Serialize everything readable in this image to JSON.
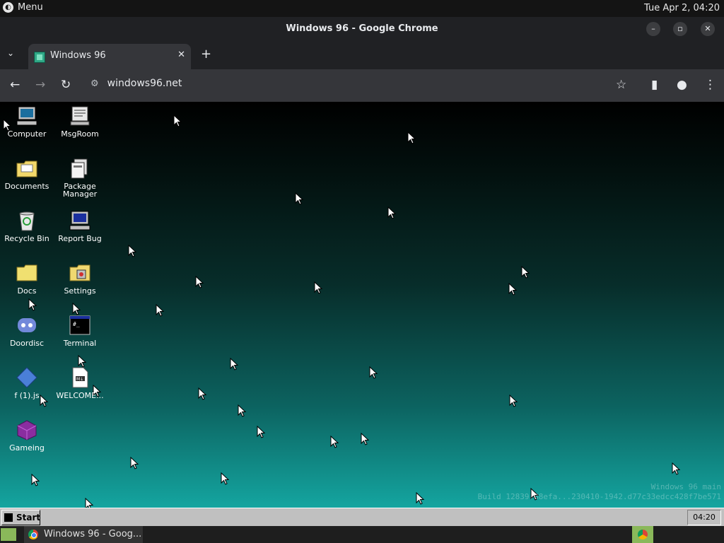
{
  "os_topbar": {
    "menu_label": "Menu",
    "datetime": "Tue Apr 2, 04:20"
  },
  "browser": {
    "window_title": "Windows 96 - Google Chrome",
    "tab_title": "Windows 96",
    "url": "windows96.net"
  },
  "desktop": {
    "icons": [
      {
        "label": "Computer",
        "icon": "computer-icon"
      },
      {
        "label": "MsgRoom",
        "icon": "msgroom-icon"
      },
      {
        "label": "Documents",
        "icon": "documents-folder-icon"
      },
      {
        "label": "Package Manager",
        "icon": "package-manager-icon"
      },
      {
        "label": "Recycle Bin",
        "icon": "recycle-bin-icon"
      },
      {
        "label": "Report Bug",
        "icon": "report-bug-icon"
      },
      {
        "label": "Docs",
        "icon": "folder-icon"
      },
      {
        "label": "Settings",
        "icon": "settings-icon"
      },
      {
        "label": "Doordisc",
        "icon": "doordisc-icon"
      },
      {
        "label": "Terminal",
        "icon": "terminal-icon"
      },
      {
        "label": "f (1).js",
        "icon": "js-file-icon"
      },
      {
        "label": "WELCOME...",
        "icon": "markdown-file-icon"
      },
      {
        "label": "Gameing",
        "icon": "gameing-icon"
      }
    ],
    "build_line1": "Windows 96 main",
    "build_line2": "Build 12839.88efa...230410-1942.d77c33edcc428f7be571"
  },
  "win96_taskbar": {
    "start_label": "Start",
    "clock": "04:20"
  },
  "os_taskbar": {
    "window_label": "Windows 96 - Goog..."
  },
  "colors": {
    "accent_teal": "#14a5a0",
    "mint_green": "#8ab85a"
  }
}
